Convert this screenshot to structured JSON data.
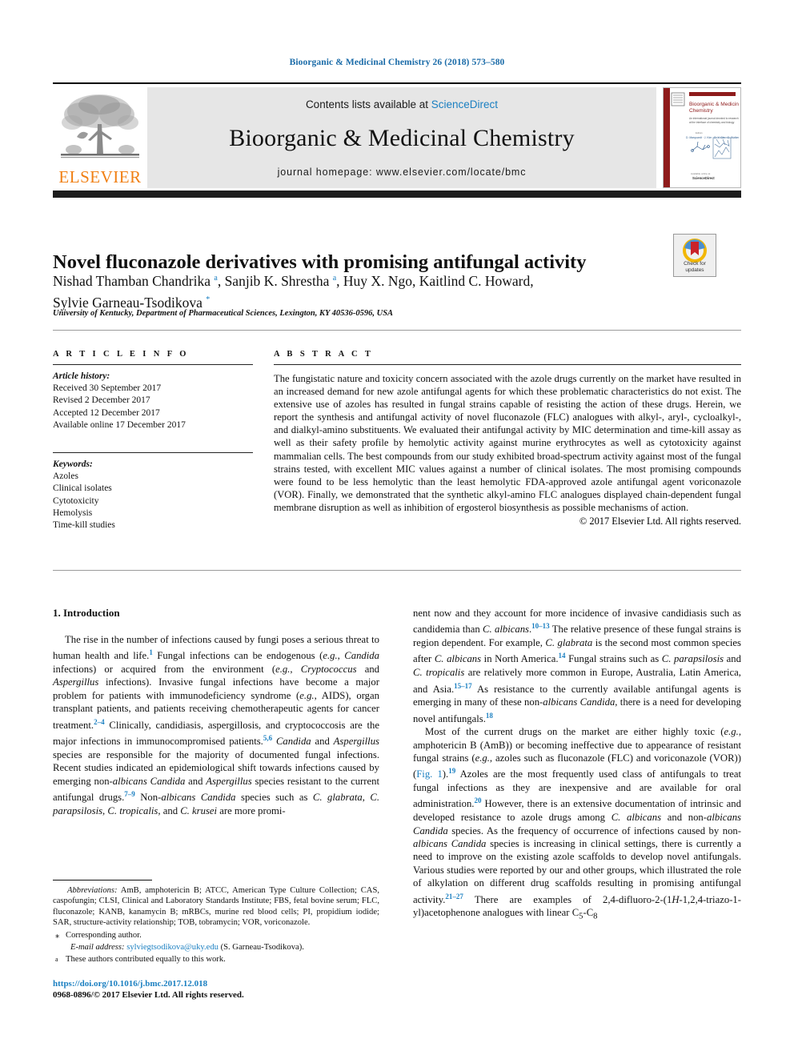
{
  "running_head": "Bioorganic & Medicinal Chemistry 26 (2018) 573–580",
  "masthead": {
    "contents_prefix": "Contents lists available at ",
    "sciencedirect": "ScienceDirect",
    "journal_name": "Bioorganic & Medicinal Chemistry",
    "homepage": "journal homepage: www.elsevier.com/locate/bmc",
    "publisher": "ELSEVIER",
    "cover_title": "Bioorganic & Medicinal Chemistry"
  },
  "article": {
    "title": "Novel fluconazole derivatives with promising antifungal activity",
    "authors_line1": "Nishad Thamban Chandrika <sup class=\"sup-blue\">a</sup>, Sanjib K. Shrestha <sup class=\"sup-blue\">a</sup>, Huy X. Ngo, Kaitlind C. Howard,",
    "authors_line2": "Sylvie Garneau-Tsodikova <sup class=\"sup-blue\">*</sup>",
    "affiliation": "University of Kentucky, Department of Pharmaceutical Sciences, Lexington, KY 40536-0596, USA",
    "crossmark_label": "Check for updates"
  },
  "article_info": {
    "heading": "A R T I C L E  I N F O",
    "history_label": "Article history:",
    "history": [
      "Received 30 September 2017",
      "Revised 2 December 2017",
      "Accepted 12 December 2017",
      "Available online 17 December 2017"
    ],
    "keywords_label": "Keywords:",
    "keywords": [
      "Azoles",
      "Clinical isolates",
      "Cytotoxicity",
      "Hemolysis",
      "Time-kill studies"
    ]
  },
  "abstract": {
    "heading": "A B S T R A C T",
    "text": "The fungistatic nature and toxicity concern associated with the azole drugs currently on the market have resulted in an increased demand for new azole antifungal agents for which these problematic characteristics do not exist. The extensive use of azoles has resulted in fungal strains capable of resisting the action of these drugs. Herein, we report the synthesis and antifungal activity of novel fluconazole (FLC) analogues with alkyl-, aryl-, cycloalkyl-, and dialkyl-amino substituents. We evaluated their antifungal activity by MIC determination and time-kill assay as well as their safety profile by hemolytic activity against murine erythrocytes as well as cytotoxicity against mammalian cells. The best compounds from our study exhibited broad-spectrum activity against most of the fungal strains tested, with excellent MIC values against a number of clinical isolates. The most promising compounds were found to be less hemolytic than the least hemolytic FDA-approved azole antifungal agent voriconazole (VOR). Finally, we demonstrated that the synthetic alkyl-amino FLC analogues displayed chain-dependent fungal membrane disruption as well as inhibition of ergosterol biosynthesis as possible mechanisms of action.",
    "copyright": "© 2017 Elsevier Ltd. All rights reserved."
  },
  "body": {
    "section_heading": "1. Introduction",
    "left_para_1": "The rise in the number of infections caused by fungi poses a serious threat to human health and life.<sup class=\"ref\">1</sup> Fungal infections can be endogenous (<i>e.g.</i>, <i>Candida</i> infections) or acquired from the environment (<i>e.g.</i>, <i>Cryptococcus</i> and <i>Aspergillus</i> infections). Invasive fungal infections have become a major problem for patients with immunodeficiency syndrome (<i>e.g.</i>, AIDS), organ transplant patients, and patients receiving chemotherapeutic agents for cancer treatment.<sup class=\"ref\">2–4</sup> Clinically, candidiasis, aspergillosis, and cryptococcosis are the major infections in immunocompromised patients.<sup class=\"ref\">5,6</sup> <i>Candida</i> and <i>Aspergillus</i> species are responsible for the majority of documented fungal infections. Recent studies indicated an epidemiological shift towards infections caused by emerging non-<i>albicans Candida</i> and <i>Aspergillus</i> species resistant to the current antifungal drugs.<sup class=\"ref\">7–9</sup> Non-<i>albicans Candida</i> species such as <i>C. glabrata</i>, <i>C. parapsilosis</i>, <i>C. tropicalis</i>, and <i>C. krusei</i> are more promi-",
    "right_para_1": "nent now and they account for more incidence of invasive candidiasis such as candidemia than <i>C. albicans</i>.<sup class=\"ref\">10–13</sup> The relative presence of these fungal strains is region dependent. For example, <i>C. glabrata</i> is the second most common species after <i>C. albicans</i> in North America.<sup class=\"ref\">14</sup> Fungal strains such as <i>C. parapsilosis</i> and <i>C. tropicalis</i> are relatively more common in Europe, Australia, Latin America, and Asia.<sup class=\"ref\">15–17</sup> As resistance to the currently available antifungal agents is emerging in many of these non-<i>albicans Candida</i>, there is a need for developing novel antifungals.<sup class=\"ref\">18</sup>",
    "right_para_2": "Most of the current drugs on the market are either highly toxic (<i>e.g.</i>, amphotericin B (AmB)) or becoming ineffective due to appearance of resistant fungal strains (<i>e.g.</i>, azoles such as fluconazole (FLC) and voriconazole (VOR)) (<span class=\"mail\">Fig. 1</span>).<sup class=\"ref\">19</sup> Azoles are the most frequently used class of antifungals to treat fungal infections as they are inexpensive and are available for oral administration.<sup class=\"ref\">20</sup> However, there is an extensive documentation of intrinsic and developed resistance to azole drugs among <i>C. albicans</i> and non-<i>albicans Candida</i> species. As the frequency of occurrence of infections caused by non-<i>albicans Candida</i> species is increasing in clinical settings, there is currently a need to improve on the existing azole scaffolds to develop novel antifungals. Various studies were reported by our and other groups, which illustrated the role of alkylation on different drug scaffolds resulting in promising antifungal activity.<sup class=\"ref\">21–27</sup> There are examples of 2,4-difluoro-2-(1<i>H</i>-1,2,4-triazo-1-yl)acetophenone analogues with linear C<sub>5</sub>-C<sub>8</sub>"
  },
  "footnotes": {
    "abbreviations": "<i>Abbreviations:</i> AmB, amphotericin B; ATCC, American Type Culture Collection; CAS, caspofungin; CLSI, Clinical and Laboratory Standards Institute; FBS, fetal bovine serum; FLC, fluconazole; KANB, kanamycin B; mRBCs, murine red blood cells; PI, propidium iodide; SAR, structure-activity relationship; TOB, tobramycin; VOR, voriconazole.",
    "corresponding_marker": "⁎",
    "corresponding": "Corresponding author.",
    "email_label": "E-mail address:",
    "email": "sylviegtsodikova@uky.edu",
    "email_suffix": "(S. Garneau-Tsodikova).",
    "equal_marker": "a",
    "equal_contribution": "These authors contributed equally to this work."
  },
  "doi": {
    "url": "https://doi.org/10.1016/j.bmc.2017.12.018",
    "issn_line": "0968-0896/© 2017 Elsevier Ltd. All rights reserved."
  },
  "colors": {
    "link_blue": "#1a7fc1",
    "runhead_blue": "#1a6ba8",
    "elsevier_orange": "#f07f13",
    "masthead_grey": "#e6e6e6"
  }
}
